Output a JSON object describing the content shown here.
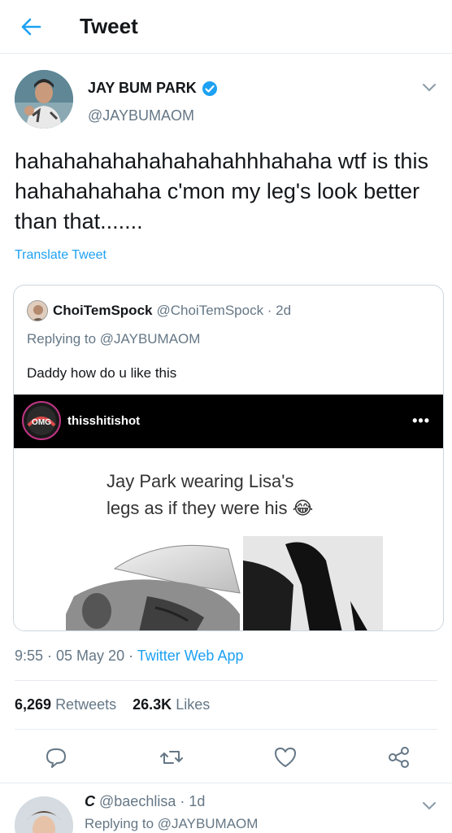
{
  "header": {
    "title": "Tweet",
    "back_icon": "arrow-left-icon"
  },
  "author": {
    "name": "JAY BUM PARK",
    "handle": "@JAYBUMAOM",
    "verified": true
  },
  "tweet": {
    "text": "hahahahahahahahahahhhahaha wtf is this hahahahahaha c'mon my leg's look better than that.......",
    "translate_label": "Translate Tweet"
  },
  "quote": {
    "name": "ChoiTemSpock",
    "handle_time": "@ChoiTemSpock · 2d",
    "replying_to": "Replying to @JAYBUMAOM",
    "text": "Daddy how do u like this",
    "media": {
      "ig_username": "thisshitishot",
      "ig_logo_text": "OMG",
      "more": "•••",
      "caption_line1": "Jay Park wearing Lisa's",
      "caption_line2": "legs as if they were his 😂"
    }
  },
  "meta": {
    "time": "9:55 · 05 May 20 · ",
    "source": "Twitter Web App"
  },
  "stats": {
    "retweets_count": "6,269",
    "retweets_label": "Retweets",
    "likes_count": "26.3K",
    "likes_label": "Likes"
  },
  "actions": [
    "reply-icon",
    "retweet-icon",
    "like-icon",
    "share-icon"
  ],
  "next_reply": {
    "name": "C",
    "handle_time": "@baechlisa · 1d",
    "sub": "Replying to @JAYBUMAOM"
  },
  "colors": {
    "accent": "#1da1f2",
    "text": "#14171a",
    "muted": "#657786",
    "border": "#e6ecf0"
  }
}
